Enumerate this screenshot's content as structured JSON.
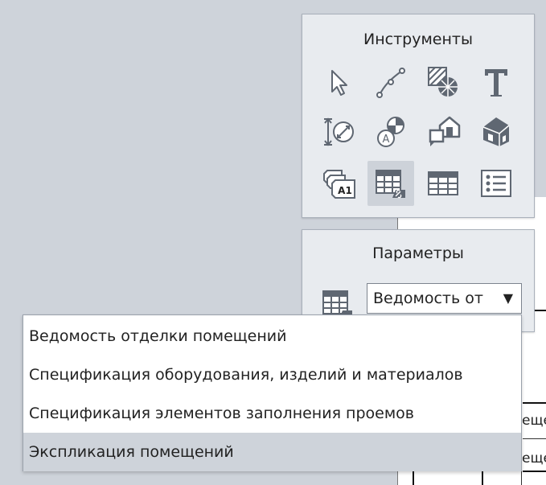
{
  "tools_panel": {
    "title": "Инструменты",
    "tools": [
      {
        "icon": "pointer-arrow-icon"
      },
      {
        "icon": "curve-line-icon"
      },
      {
        "icon": "hatch-fill-icon"
      },
      {
        "icon": "text-tool-icon"
      },
      {
        "icon": "dimension-tool-icon"
      },
      {
        "icon": "room-marker-icon"
      },
      {
        "icon": "room-house-icon"
      },
      {
        "icon": "building-3d-icon"
      },
      {
        "icon": "tag-labels-icon"
      },
      {
        "icon": "linked-schedule-icon",
        "active": true
      },
      {
        "icon": "table-schedule-icon"
      },
      {
        "icon": "list-legend-icon"
      }
    ]
  },
  "params_panel": {
    "title": "Параметры",
    "icon": "linked-schedule-icon",
    "selected_value": "Ведомость от"
  },
  "dropdown": {
    "options": [
      "Ведомость отделки помещений",
      "Спецификация оборудования, изделий и материалов",
      "Спецификация элементов заполнения проемов",
      "Экспликация помещений"
    ],
    "hovered_index": 3
  },
  "drawing": {
    "fragments": [
      "ещег",
      "ещег"
    ]
  },
  "colors": {
    "panel_bg": "#e8ebef",
    "background": "#ced3da",
    "active_tool": "#cdd2d9",
    "icon_color": "#5f6772"
  }
}
